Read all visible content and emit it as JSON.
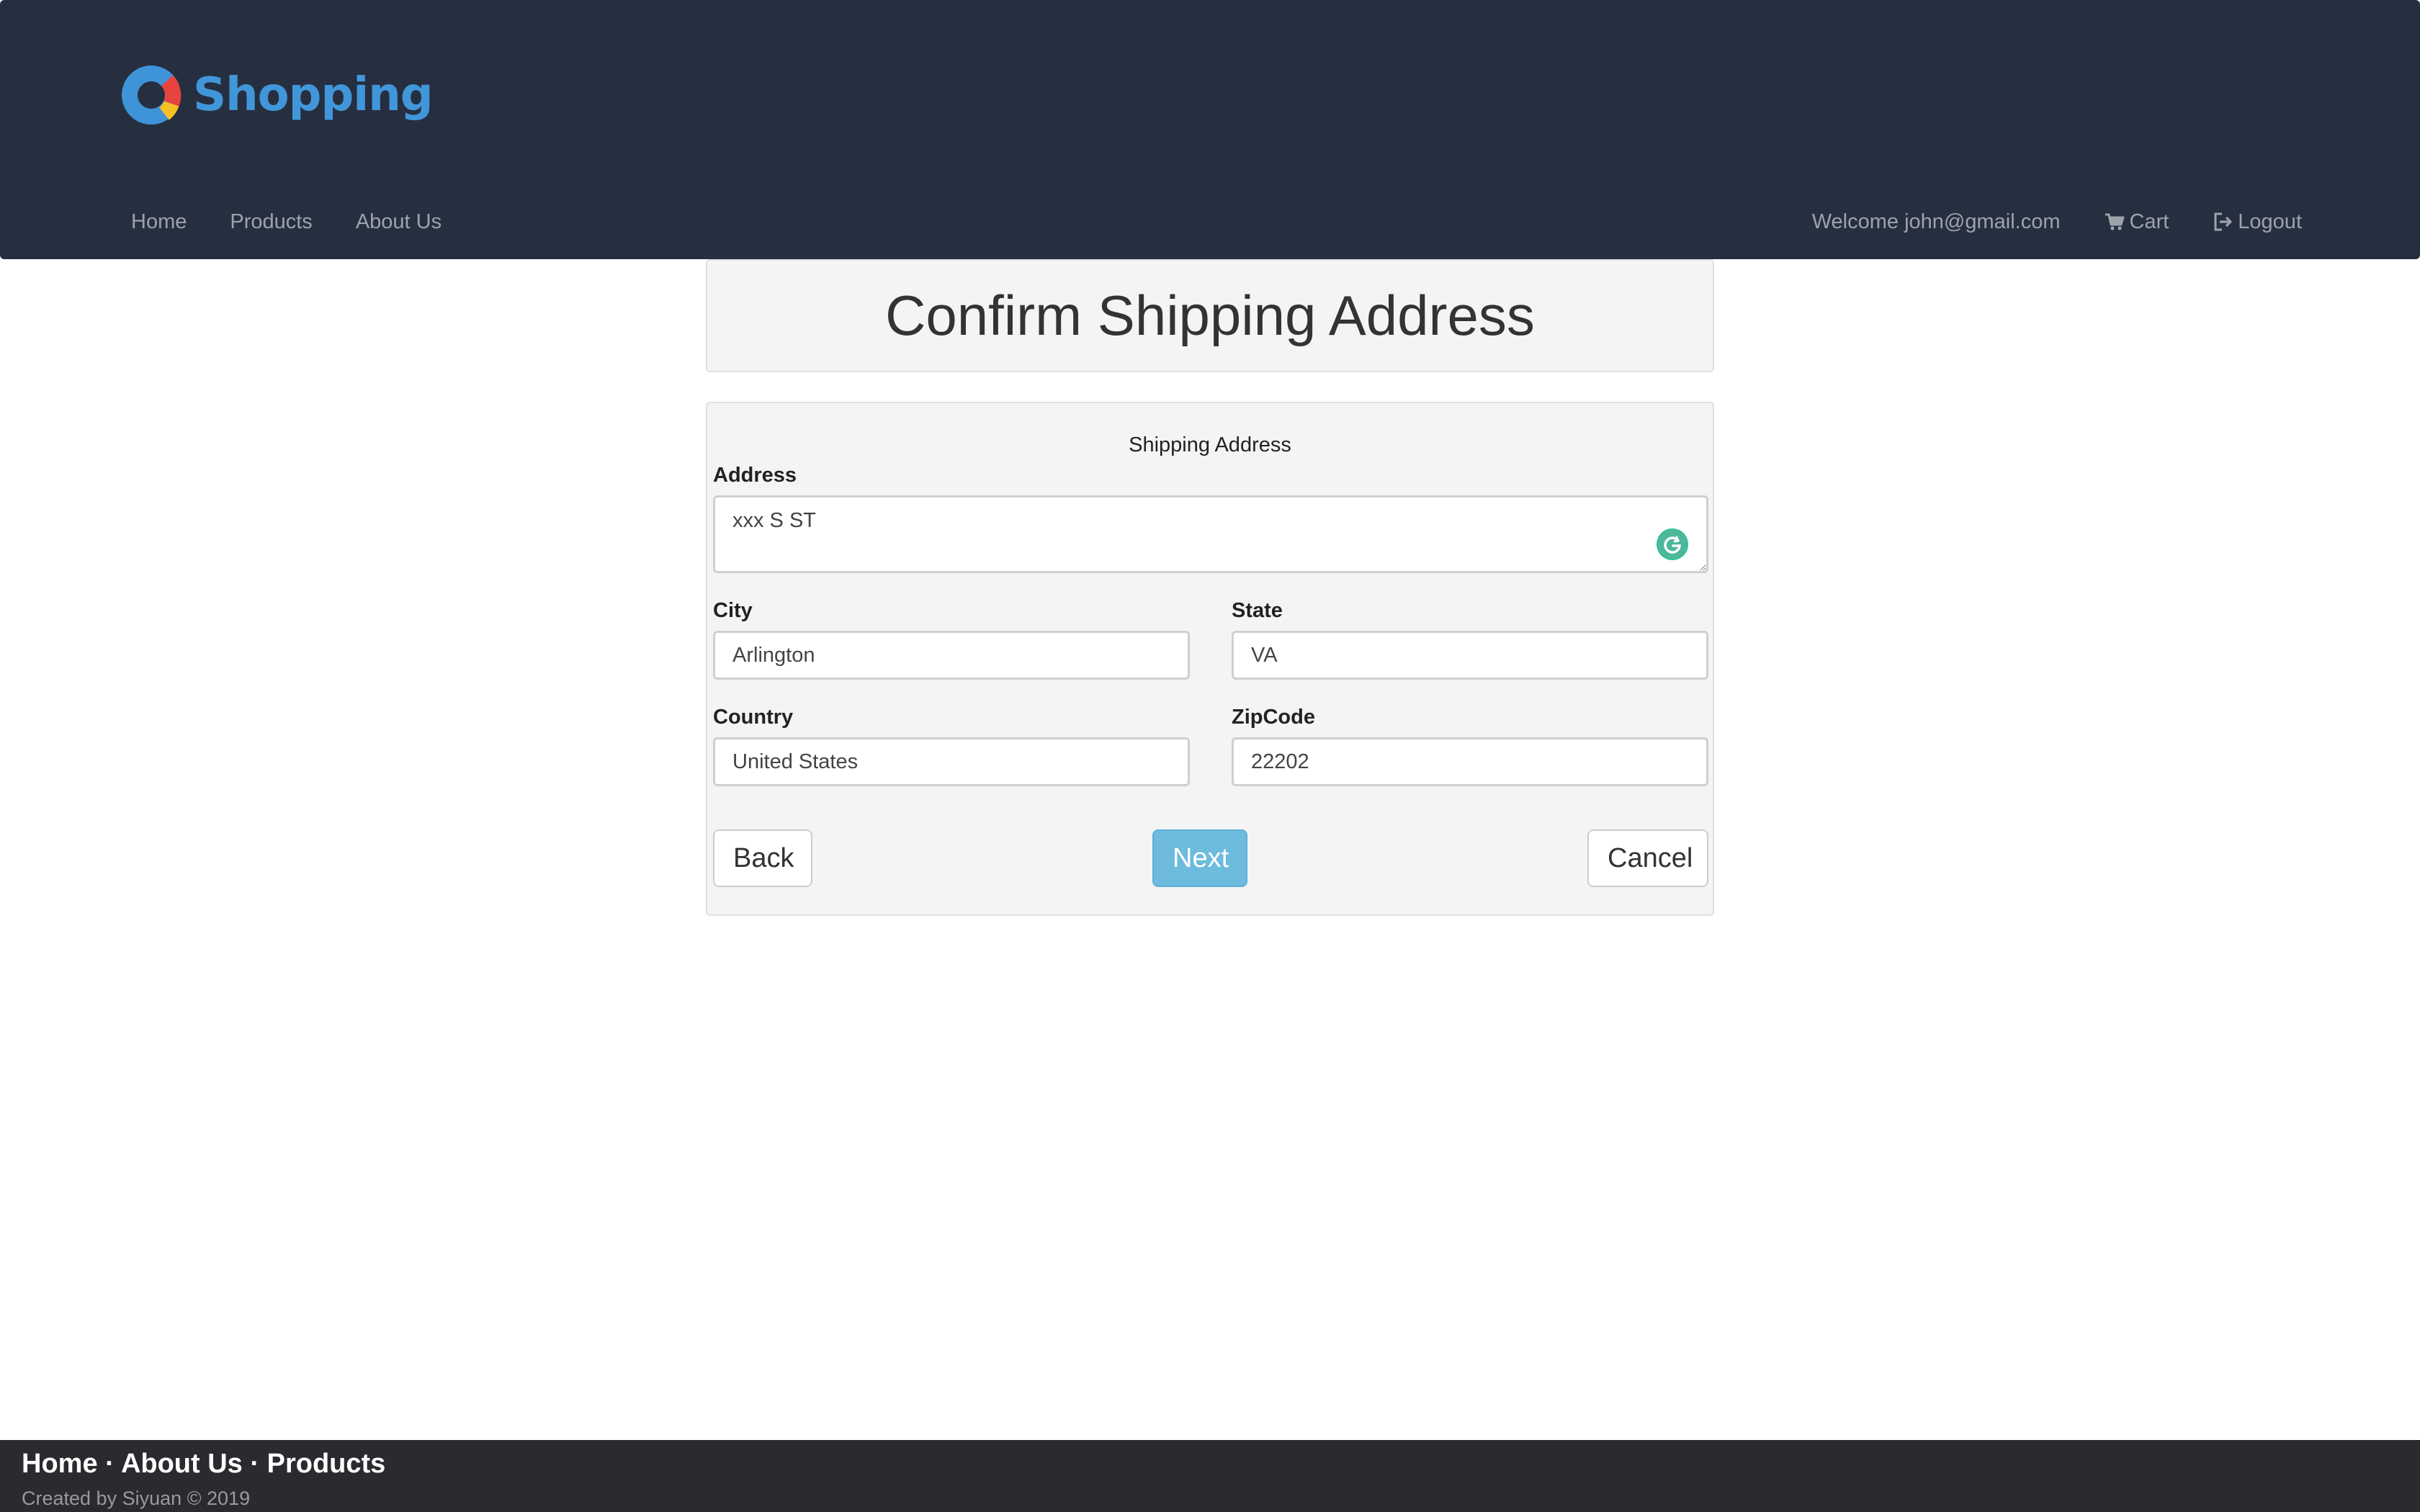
{
  "brand": {
    "name": "Shopping",
    "logo_icon": "donut-logo-icon",
    "colors": {
      "text": "#4196da",
      "ring": "#3f93d8",
      "accent_red": "#e8433f",
      "accent_yellow": "#f6c026"
    }
  },
  "nav": {
    "left": [
      {
        "label": "Home"
      },
      {
        "label": "Products"
      },
      {
        "label": "About Us"
      }
    ],
    "welcome": "Welcome john@gmail.com",
    "cart": {
      "label": "Cart",
      "icon": "shopping-cart-icon"
    },
    "logout": {
      "label": "Logout",
      "icon": "logout-icon"
    }
  },
  "page": {
    "title": "Confirm Shipping Address"
  },
  "form": {
    "caption": "Shipping Address",
    "address": {
      "label": "Address",
      "value": "xxx S ST"
    },
    "city": {
      "label": "City",
      "value": "Arlington"
    },
    "state": {
      "label": "State",
      "value": "VA"
    },
    "country": {
      "label": "Country",
      "value": "United States"
    },
    "zipcode": {
      "label": "ZipCode",
      "value": "22202"
    },
    "grammarly_icon": "grammarly-icon"
  },
  "buttons": {
    "back": "Back",
    "next": "Next",
    "cancel": "Cancel",
    "next_color": "#6dbbdd"
  },
  "footer": {
    "links": [
      {
        "label": "Home"
      },
      {
        "label": "About Us"
      },
      {
        "label": "Products"
      }
    ],
    "separator": " · ",
    "credit": "Created by Siyuan © 2019"
  },
  "theme": {
    "navbar_bg": "#262f3f",
    "footer_bg": "#2a2b2f",
    "panel_bg": "#f4f4f4"
  }
}
